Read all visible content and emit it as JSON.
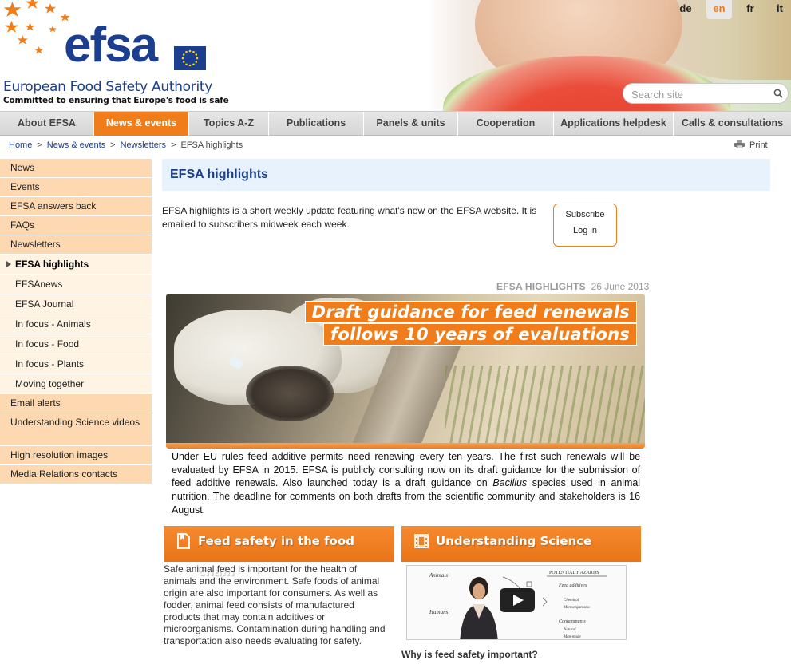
{
  "header": {
    "logo_word": "efsa",
    "org_name": "European Food Safety Authority",
    "tagline": "Committed to ensuring that Europe's food is safe",
    "languages": [
      "de",
      "en",
      "fr",
      "it"
    ],
    "active_language": "en",
    "search_placeholder": "Search site"
  },
  "nav": {
    "items": [
      "About EFSA",
      "News & events",
      "Topics A-Z",
      "Publications",
      "Panels & units",
      "Cooperation",
      "Applications helpdesk",
      "Calls & consultations"
    ],
    "active": "News & events"
  },
  "breadcrumb": {
    "items": [
      "Home",
      "News & events",
      "Newsletters",
      "EFSA highlights"
    ],
    "separator": ">"
  },
  "print_label": "Print",
  "sidebar": {
    "top_items": [
      "News",
      "Events",
      "EFSA answers back",
      "FAQs",
      "Newsletters"
    ],
    "sub_items": [
      "EFSA highlights",
      "EFSAnews",
      "EFSA Journal",
      "In focus - Animals",
      "In focus - Food",
      "In focus - Plants",
      "Moving together"
    ],
    "current": "EFSA highlights",
    "bottom_items": [
      "Email alerts",
      "Understanding Science videos",
      "High resolution images",
      "Media Relations contacts"
    ]
  },
  "page": {
    "title": "EFSA highlights",
    "intro": "EFSA highlights is a short weekly update featuring what's new on the EFSA website. It is emailed to subscribers midweek each week.",
    "subscribe_label": "Subscribe",
    "login_label": "Log in"
  },
  "newsletter": {
    "label": "EFSA HIGHLIGHTS",
    "date": "26 June 2013",
    "headline_line1": "Draft guidance for feed renewals",
    "headline_line2": "follows 10 years of evaluations",
    "story_part1": "Under EU rules feed additive permits need renewing every ten years. The first such renewals will be evaluated by EFSA in 2015. EFSA is publicly consulting now on its draft guidance for the submission of feed additive renewals. Also launched today is a draft guidance on ",
    "story_italic": "Bacillus",
    "story_part2": " species used in animal nutrition. The deadline for comments on both drafts from the scientific community and stakeholders is 16 August."
  },
  "boxes": {
    "feed": {
      "title": "Feed safety in the food chain",
      "text": "Safe animal feed is important for the health of animals and the environment. Safe foods of animal origin are also important for consumers. As well as fodder, animal feed consists of manufactured products that may contain additives or microorganisms. Contamination during handling and transportation also needs evaluating for safety."
    },
    "science": {
      "title": "Understanding Science",
      "video_caption": "Why is feed safety important?",
      "whiteboard_labels": [
        "POTENTIAL HAZARDS",
        "Animals",
        "Feed additives",
        "Chemical",
        "Microorganisms",
        "Humans",
        "Contaminants",
        "Natural",
        "Man-made"
      ]
    }
  },
  "colors": {
    "brand_orange": "#f07d1a",
    "brand_blue": "#1b3e8f",
    "sidebar_peach": "#fdd8b0",
    "sidebar_sub": "#fff4e4",
    "title_bar": "#e8f2fc"
  }
}
